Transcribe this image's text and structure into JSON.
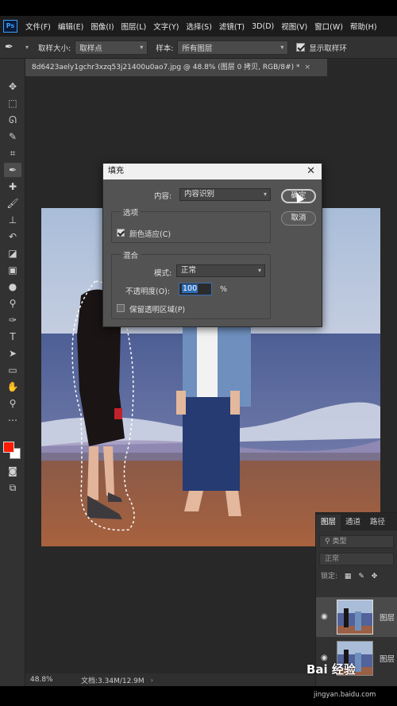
{
  "app": {
    "logo": "Ps"
  },
  "menu": [
    "文件(F)",
    "编辑(E)",
    "图像(I)",
    "图层(L)",
    "文字(Y)",
    "选择(S)",
    "滤镜(T)",
    "3D(D)",
    "视图(V)",
    "窗口(W)",
    "帮助(H)"
  ],
  "options": {
    "sample_size_label": "取样大小:",
    "sample_size_value": "取样点",
    "sample_label": "样本:",
    "sample_value": "所有图层",
    "show_ring_label": "显示取样环",
    "show_ring_checked": true
  },
  "document": {
    "tab_title": "8d6423aely1gchr3xzq53j21400u0ao7.jpg @ 48.8% (图层 0 拷贝, RGB/8#) *",
    "tab_close": "×"
  },
  "status": {
    "zoom": "48.8%",
    "doc_size": "文档:3.34M/12.9M",
    "arrow": "›"
  },
  "dialog": {
    "title": "填充",
    "close": "✕",
    "content_label": "内容:",
    "content_value": "内容识别",
    "options_group": "选项",
    "color_adapt_label": "颜色适应(C)",
    "color_adapt_checked": true,
    "blend_group": "混合",
    "mode_label": "模式:",
    "mode_value": "正常",
    "opacity_label": "不透明度(O):",
    "opacity_value": "100",
    "opacity_unit": "%",
    "preserve_label": "保留透明区域(P)",
    "preserve_checked": false,
    "ok": "确定",
    "cancel": "取消"
  },
  "layers": {
    "tabs": [
      "图层",
      "通道",
      "路径"
    ],
    "filter_placeholder": "类型",
    "blend_mode": "正常",
    "lock_label": "锁定:",
    "items": [
      {
        "name": "图层",
        "selected": true
      },
      {
        "name": "图层",
        "selected": false
      }
    ]
  },
  "watermark": {
    "brand": "Bai 经验",
    "url": "jingyan.baidu.com"
  },
  "colors": {
    "foreground": "#ff1a00",
    "background": "#ffffff",
    "accent": "#3a6fb5"
  }
}
